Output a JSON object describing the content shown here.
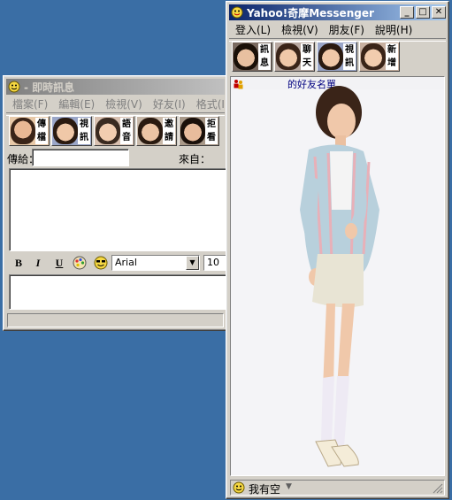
{
  "im_window": {
    "title": "- 即時訊息",
    "menu": [
      "檔案(F)",
      "編輯(E)",
      "檢視(V)",
      "好友(I)",
      "格式(I)"
    ],
    "toolbar": [
      {
        "label": "傳檔",
        "icon": "send-file-face-icon"
      },
      {
        "label": "視訊",
        "icon": "webcam-face-icon"
      },
      {
        "label": "語音",
        "icon": "voice-face-icon"
      },
      {
        "label": "邀請",
        "icon": "invite-face-icon"
      },
      {
        "label": "拒看",
        "icon": "ignore-face-icon"
      }
    ],
    "to_label": "傳給：",
    "to_value": "",
    "from_label": "來自：",
    "font_name": "Arial",
    "font_size": "10",
    "format_buttons": {
      "bold": "B",
      "italic": "I",
      "underline": "U"
    }
  },
  "messenger": {
    "title": "Yahoo!奇摩Messenger",
    "menu": [
      "登入(L)",
      "檢視(V)",
      "朋友(F)",
      "說明(H)"
    ],
    "toolbar": [
      {
        "label": "訊息",
        "icon": "message-face-icon"
      },
      {
        "label": "聊天",
        "icon": "chat-face-icon"
      },
      {
        "label": "視訊",
        "icon": "webcam-face-icon"
      },
      {
        "label": "新增",
        "icon": "add-friend-face-icon"
      }
    ],
    "friends_header": "的好友名單",
    "status": "我有空"
  },
  "colors": {
    "desktop": "#3a6ea5",
    "title_active": "#0a246a",
    "title_inactive": "#808080",
    "window_face": "#d4d0c8"
  }
}
